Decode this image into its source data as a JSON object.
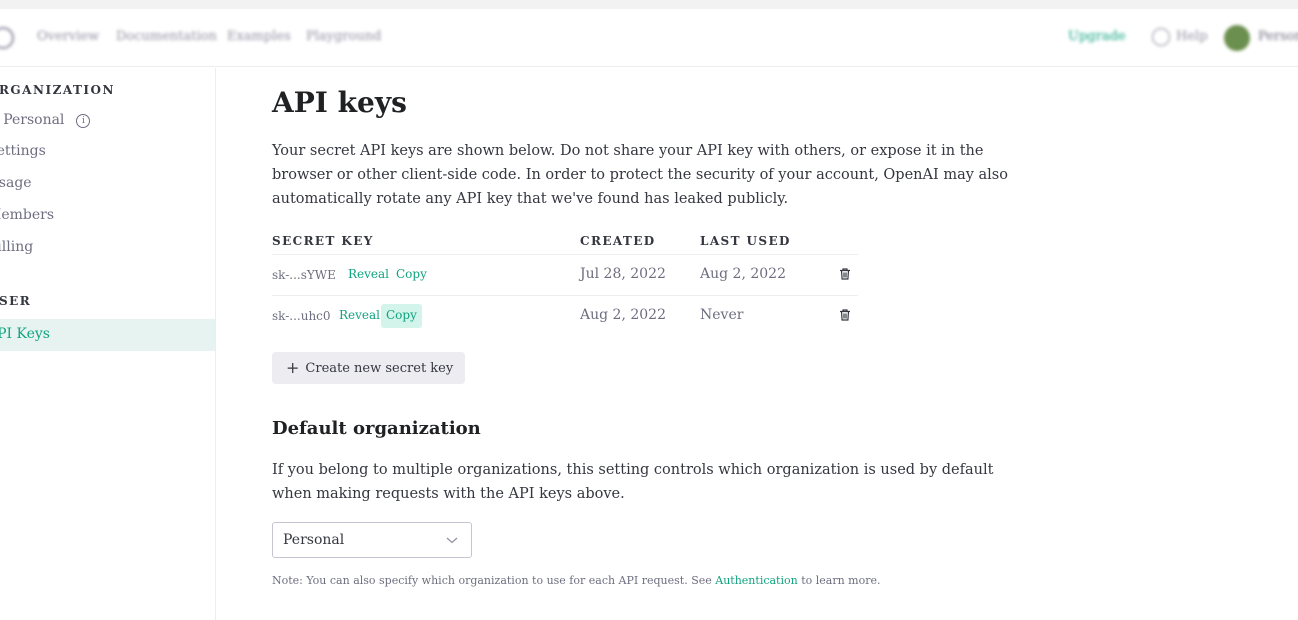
{
  "nav": {
    "links": [
      "Overview",
      "Documentation",
      "Examples",
      "Playground"
    ],
    "upgrade": "Upgrade",
    "help": "Help",
    "account": "Personal"
  },
  "sidebar": {
    "organization_heading": "ORGANIZATION",
    "org_name": "Personal",
    "org_items": [
      "Settings",
      "Usage",
      "Members",
      "Billing"
    ],
    "user_heading": "USER",
    "user_items": [
      "API Keys"
    ]
  },
  "main": {
    "title": "API keys",
    "intro": "Your secret API keys are shown below. Do not share your API key with others, or expose it in the browser or other client-side code. In order to protect the security of your account, OpenAI may also automatically rotate any API key that we've found has leaked publicly.",
    "table": {
      "headers": [
        "SECRET KEY",
        "CREATED",
        "LAST USED"
      ],
      "rows": [
        {
          "key": "sk-...sYWE",
          "reveal": "Reveal",
          "copy": "Copy",
          "created": "Jul 28, 2022",
          "last_used": "Aug 2, 2022"
        },
        {
          "key": "sk-...uhc0",
          "reveal": "Reveal",
          "copy": "Copy",
          "created": "Aug 2, 2022",
          "last_used": "Never"
        }
      ]
    },
    "create_button": "Create new secret key",
    "default_org": {
      "heading": "Default organization",
      "description": "If you belong to multiple organizations, this setting controls which organization is used by default when making requests with the API keys above.",
      "selected": "Personal",
      "note_prefix": "Note: You can also specify which organization to use for each API request. See ",
      "note_link": "Authentication",
      "note_suffix": " to learn more."
    }
  },
  "colors": {
    "accent": "#10a37f",
    "active_bg": "#e6f3f1",
    "copy_active_bg": "#d2f4ea",
    "button_bg": "#ececf1"
  }
}
